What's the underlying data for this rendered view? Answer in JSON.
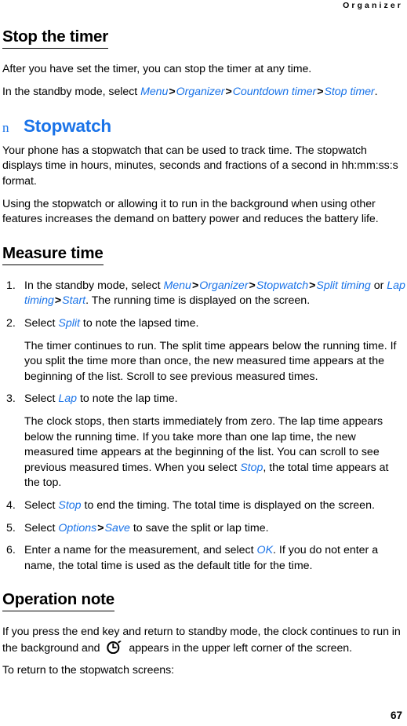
{
  "running_header": "Organizer",
  "colors": {
    "link_blue": "#1a73e8",
    "text_black": "#000000",
    "page_background": "#ffffff"
  },
  "sections": {
    "stop_the_timer": {
      "heading": "Stop the timer",
      "paragraph": "After you have set the timer, you can stop the timer at any time.",
      "path_intro": "In the standby mode, select ",
      "path_items": [
        "Menu",
        "Organizer",
        "Countdown timer",
        "Stop timer"
      ],
      "path_terminator": "."
    },
    "stopwatch": {
      "marker": "n",
      "heading": "Stopwatch",
      "paragraph_1": "Your phone has a stopwatch that can be used to track time. The stopwatch displays time in hours, minutes, seconds and fractions of a second in hh:mm:ss:s format.",
      "paragraph_2": "Using the stopwatch or allowing it to run in the background when using other features increases the demand on battery power and reduces the battery life."
    },
    "measure_time": {
      "heading": "Measure time",
      "steps": [
        {
          "number": "1.",
          "lead": "In the standby mode, select ",
          "items": [
            "Menu",
            "Organizer",
            "Stopwatch",
            "Split timing"
          ],
          "conjunction": " or ",
          "items2": [
            "Lap timing",
            "Start"
          ],
          "tail": ". The running time is displayed on the screen.",
          "note": ""
        },
        {
          "number": "2.",
          "lead": "Select ",
          "items": [
            "Split"
          ],
          "tail": " to note the lapsed time.",
          "note": "The timer continues to run. The split time appears below the running time. If you split the time more than once, the new measured time appears at the beginning of the list. Scroll to see previous measured times."
        },
        {
          "number": "3.",
          "lead": "Select ",
          "items": [
            "Lap"
          ],
          "tail": " to note the lap time.",
          "note_part_1": "The clock stops, then starts immediately from zero. The lap time appears below the running time. If you take more than one lap time, the new measured time appears at the beginning of the list. You can scroll to see previous measured times. When you select ",
          "note_link": "Stop",
          "note_part_2": ", the total time appears at the top."
        },
        {
          "number": "4.",
          "lead": "Select ",
          "items": [
            "Stop"
          ],
          "tail": " to end the timing. The total time is displayed on the screen.",
          "note": ""
        },
        {
          "number": "5.",
          "lead": "Select ",
          "items": [
            "Options",
            "Save"
          ],
          "tail": " to save the split or lap time.",
          "note": ""
        },
        {
          "number": "6.",
          "lead": "Enter a name for the measurement, and select ",
          "items": [
            "OK"
          ],
          "tail": ". If you do not enter a name, the total time is used as the default title for the time.",
          "note": ""
        }
      ]
    },
    "operation_note": {
      "heading": "Operation note",
      "paragraph_part_1": "If you press the end key and return to standby mode, the clock continues to run in the background and ",
      "icon_name": "stopwatch-icon",
      "paragraph_part_2": " appears in the upper left corner of the screen.",
      "paragraph_2": "To return to the stopwatch screens:"
    }
  },
  "folio": "67"
}
